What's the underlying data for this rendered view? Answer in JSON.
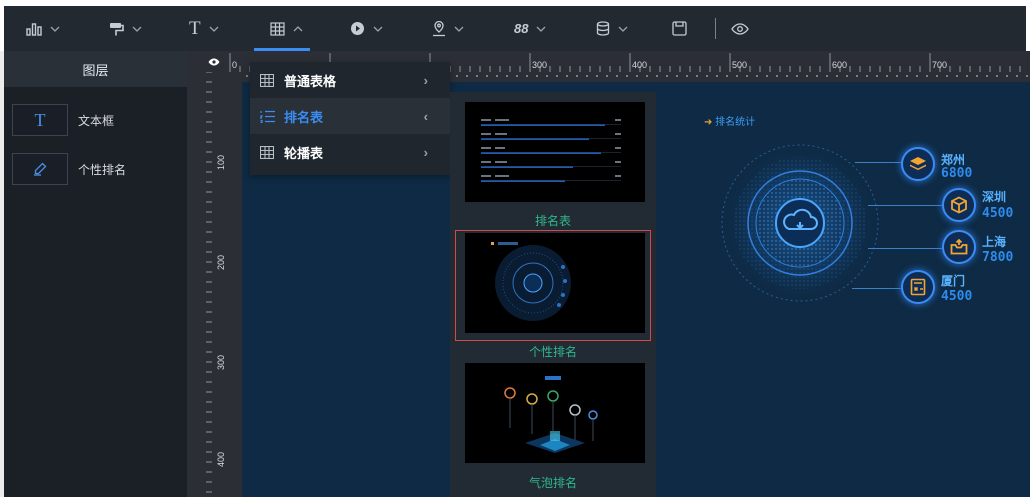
{
  "toolbar": {
    "items": [
      "chart",
      "brush",
      "text",
      "table",
      "media",
      "map",
      "decoration",
      "database",
      "save",
      "preview"
    ]
  },
  "layers": {
    "title": "图层",
    "items": [
      {
        "label": "文本框",
        "icon": "text-icon"
      },
      {
        "label": "个性排名",
        "icon": "pen-icon"
      }
    ]
  },
  "rulers": {
    "top_labels": [
      "0",
      "300",
      "400",
      "500",
      "600",
      "700"
    ],
    "left_labels": [
      "100",
      "200",
      "300",
      "400"
    ]
  },
  "dropdown": {
    "items": [
      {
        "label": "普通表格",
        "arrow": "›",
        "active": false
      },
      {
        "label": "排名表",
        "arrow": "‹",
        "active": true
      },
      {
        "label": "轮播表",
        "arrow": "›",
        "active": false
      }
    ]
  },
  "submenu": {
    "items": [
      {
        "label": "排名表",
        "selected": false
      },
      {
        "label": "个性排名",
        "selected": true
      },
      {
        "label": "气泡排名",
        "selected": false
      }
    ]
  },
  "screen": {
    "title": "排名统计",
    "cities": [
      {
        "name": "郑州",
        "value": "6800",
        "icon": "layers-icon"
      },
      {
        "name": "深圳",
        "value": "4500",
        "icon": "box-icon"
      },
      {
        "name": "上海",
        "value": "7800",
        "icon": "inbox-icon"
      },
      {
        "name": "厦门",
        "value": "4500",
        "icon": "calculator-icon"
      }
    ]
  },
  "colors": {
    "accent": "#3b8cf3",
    "label_green": "#2fb88c",
    "screen_bg": "#0e2a44",
    "selected_border": "#d24a4a"
  }
}
